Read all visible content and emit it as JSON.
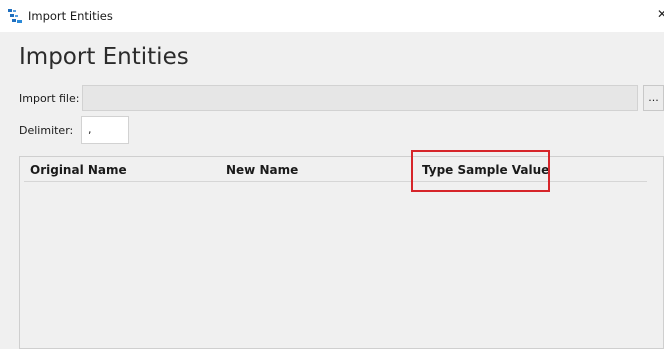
{
  "window": {
    "title": "Import Entities",
    "close_glyph": "✕"
  },
  "page": {
    "heading": "Import Entities"
  },
  "form": {
    "import_file_label": "Import file:",
    "import_file_value": "",
    "browse_label": "...",
    "delimiter_label": "Delimiter:",
    "delimiter_value": ","
  },
  "grid": {
    "columns": [
      "Original Name",
      "New Name",
      "Type Sample Value"
    ],
    "rows": []
  },
  "colors": {
    "highlight": "#d6252a"
  },
  "icons": {
    "app": "import-entities-app-icon",
    "close": "close-icon"
  }
}
